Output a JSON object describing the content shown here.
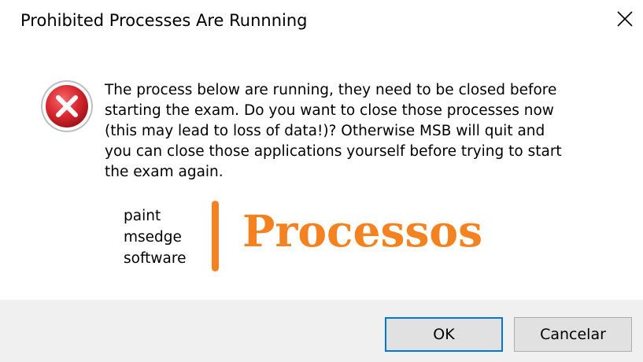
{
  "dialog": {
    "title": "Prohibited Processes Are Runnning",
    "close_icon": "close-icon",
    "status_icon": "error-icon",
    "message": "The process below are running, they need to be closed before\nstarting the exam. Do you want to close those processes now\n(this may lead to loss of data!)? Otherwise MSB will quit and\nyou can close those applications yourself before trying to start\nthe exam again.",
    "processes": [
      "paint",
      "msedge",
      "software"
    ],
    "annotation": "Processos",
    "buttons": {
      "ok_label": "OK",
      "cancel_label": "Cancelar"
    }
  },
  "colors": {
    "annotation": "#f58220",
    "error_red": "#d9272e",
    "footer_bg": "#f0f0f0",
    "button_bg": "#e1e1e1",
    "focus_border": "#0078d7"
  }
}
